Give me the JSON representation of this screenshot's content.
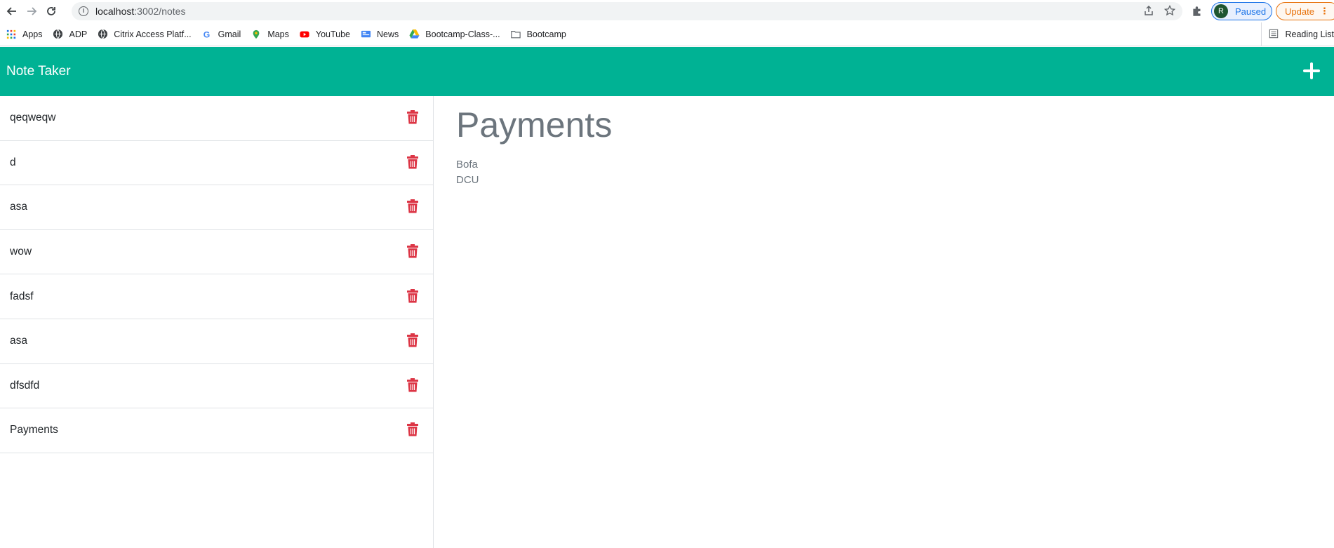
{
  "browser": {
    "url_host": "localhost",
    "url_path": ":3002/notes",
    "profile_initial": "R",
    "profile_status": "Paused",
    "update_label": "Update",
    "bookmarks": [
      {
        "label": "Apps",
        "icon": "apps-grid-icon"
      },
      {
        "label": "ADP",
        "icon": "globe-icon"
      },
      {
        "label": "Citrix Access Platf...",
        "icon": "globe-icon"
      },
      {
        "label": "Gmail",
        "icon": "google-icon"
      },
      {
        "label": "Maps",
        "icon": "maps-pin-icon"
      },
      {
        "label": "YouTube",
        "icon": "youtube-icon"
      },
      {
        "label": "News",
        "icon": "news-icon"
      },
      {
        "label": "Bootcamp-Class-...",
        "icon": "drive-icon"
      },
      {
        "label": "Bootcamp",
        "icon": "folder-icon"
      }
    ],
    "reading_list": "Reading List"
  },
  "app": {
    "brand": "Note Taker",
    "accent": "#00b294",
    "trash_color": "#dc3545"
  },
  "notes": [
    {
      "title": "qeqweqw"
    },
    {
      "title": "d"
    },
    {
      "title": "asa"
    },
    {
      "title": "wow"
    },
    {
      "title": "fadsf"
    },
    {
      "title": "asa"
    },
    {
      "title": "dfsdfd"
    },
    {
      "title": "Payments"
    }
  ],
  "active_note": {
    "title": "Payments",
    "text": "Bofa\nDCU"
  }
}
